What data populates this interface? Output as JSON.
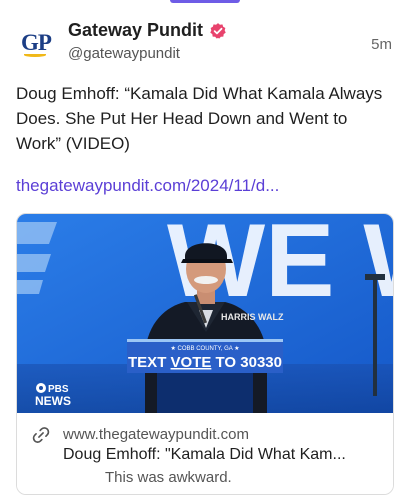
{
  "account": {
    "avatar_text": "GP",
    "display_name": "Gateway Pundit",
    "handle": "@gatewaypundit",
    "time": "5m",
    "verified_color": "#e8436d"
  },
  "post": {
    "text": "Doug Emhoff: “Kamala Did What Kamala Always Does. She Put Her Head Down and Went to Work” (VIDEO)",
    "link": "thegatewaypundit.com/2024/11/d..."
  },
  "card": {
    "image": {
      "backdrop_text": "WE W",
      "sign_small": "★ COBB COUNTY, GA ★",
      "sign_main_before": "TEXT ",
      "sign_main_vote": "VOTE",
      "sign_main_after": " TO 30330",
      "jacket_text": "HARRIS WALZ",
      "watermark_top": "PBS",
      "watermark_bottom": "NEWS"
    },
    "domain": "www.thegatewaypundit.com",
    "title": "Doug Emhoff: \"Kamala Did What Kam...",
    "description": "This was awkward."
  },
  "colors": {
    "link": "#5b3fd6",
    "backdrop": "#1d6ee0",
    "sign": "#2a5fc8",
    "accent_bar": "#6e5ce6"
  }
}
